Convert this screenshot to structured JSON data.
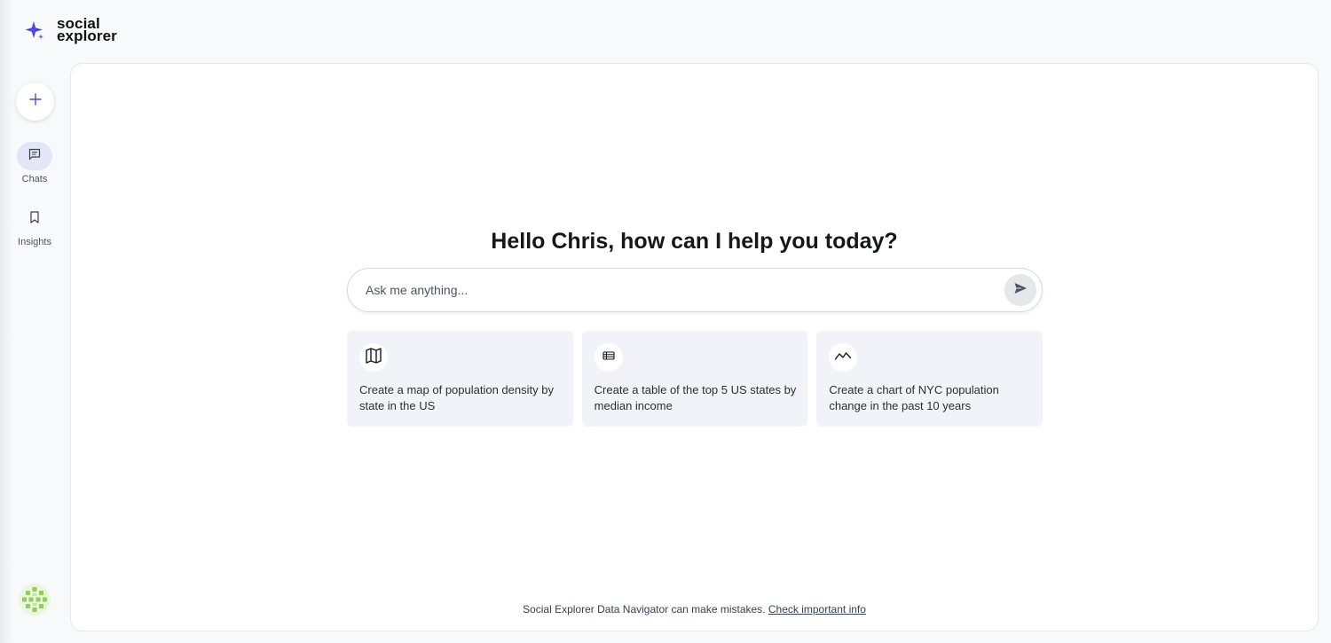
{
  "brand": {
    "name_line1": "social",
    "name_line2": "explorer",
    "accent_color": "#4f46e5",
    "logo_icon": "sparkle-icon"
  },
  "sidebar": {
    "new_chat_icon": "plus-icon",
    "items": [
      {
        "label": "Chats",
        "icon": "chat-icon",
        "active": true
      },
      {
        "label": "Insights",
        "icon": "bookmark-icon",
        "active": false
      }
    ]
  },
  "main": {
    "greeting": "Hello Chris, how can I help you today?",
    "input_placeholder": "Ask me anything...",
    "send_icon": "send-icon",
    "suggestions": [
      {
        "icon": "map-icon",
        "text": "Create a map of population density by state in the US"
      },
      {
        "icon": "table-icon",
        "text": "Create a table of the top 5 US states by median income"
      },
      {
        "icon": "chart-line-icon",
        "text": "Create a chart of NYC population change in the past 10 years"
      }
    ]
  },
  "footer": {
    "disclaimer": "Social Explorer Data Navigator can make mistakes.",
    "link_text": "Check important info"
  }
}
